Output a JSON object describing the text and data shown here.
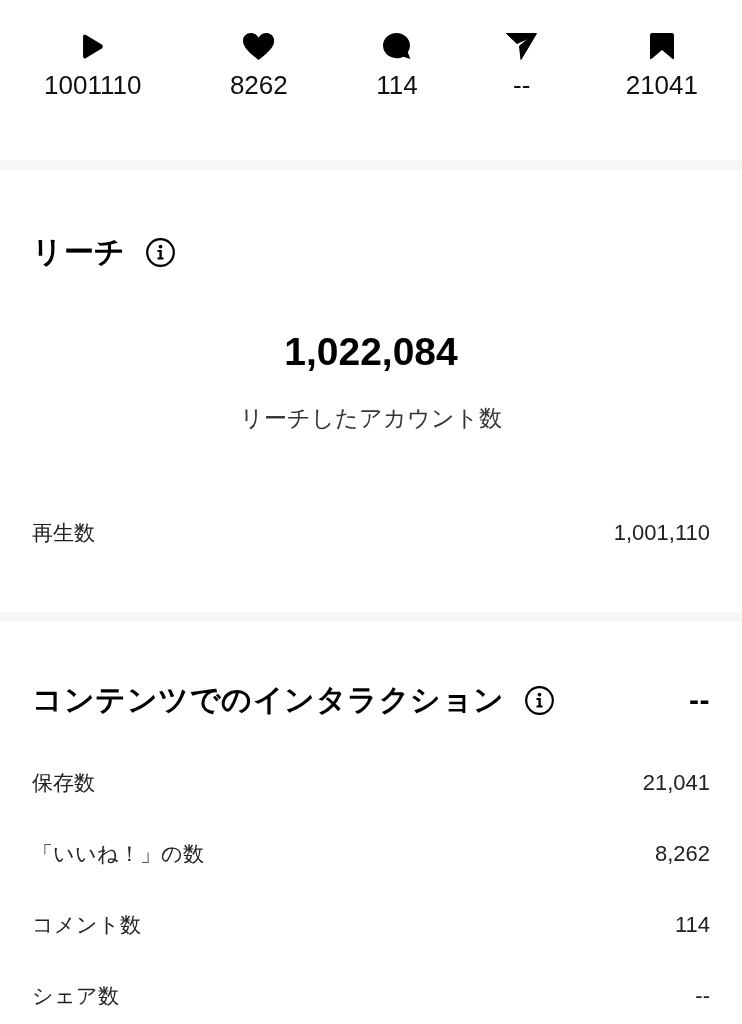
{
  "stats": [
    {
      "kind": "play",
      "value": "1001110"
    },
    {
      "kind": "like",
      "value": "8262"
    },
    {
      "kind": "comment",
      "value": "114"
    },
    {
      "kind": "share",
      "value": "--"
    },
    {
      "kind": "save",
      "value": "21041"
    }
  ],
  "reach": {
    "title": "リーチ",
    "total": "1,022,084",
    "total_label": "リーチしたアカウント数",
    "rows": [
      {
        "label": "再生数",
        "value": "1,001,110"
      }
    ]
  },
  "interactions": {
    "title": "コンテンツでのインタラクション",
    "total": "--",
    "rows": [
      {
        "label": "保存数",
        "value": "21,041"
      },
      {
        "label": "「いいね！」の数",
        "value": "8,262"
      },
      {
        "label": "コメント数",
        "value": "114"
      },
      {
        "label": "シェア数",
        "value": "--"
      }
    ]
  }
}
